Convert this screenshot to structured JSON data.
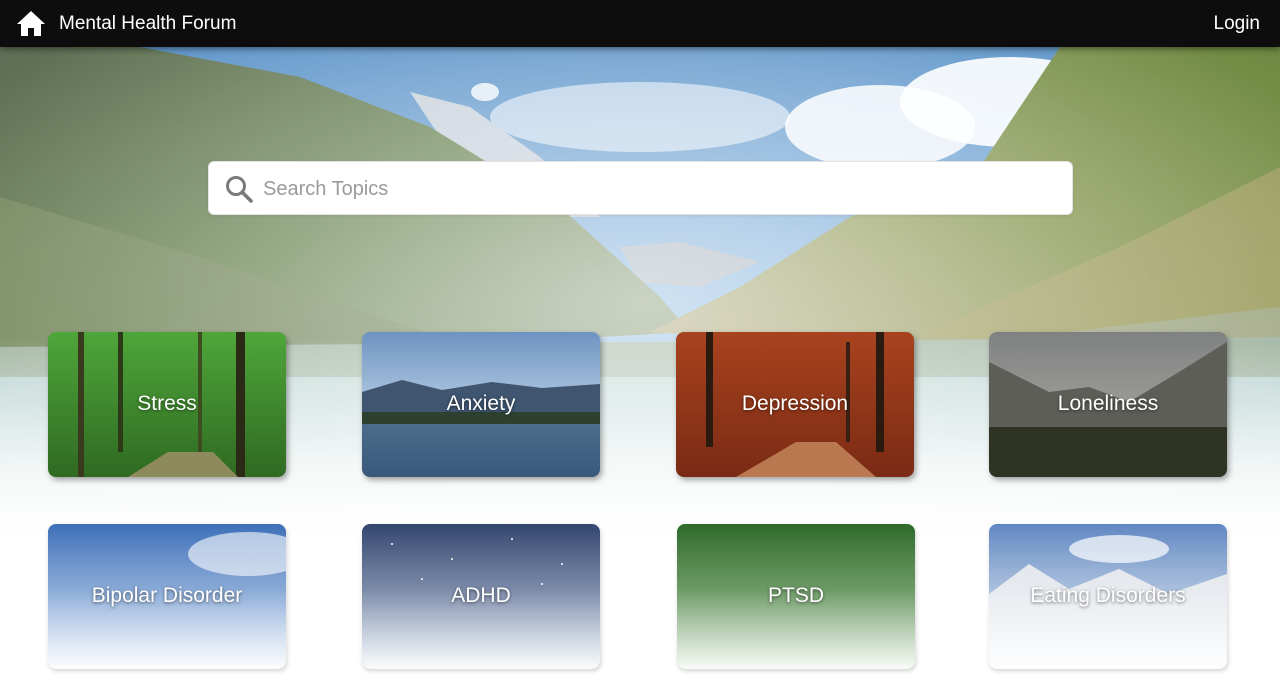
{
  "navbar": {
    "home_icon": "home-icon",
    "brand": "Mental Health Forum",
    "login": "Login"
  },
  "hero": {
    "background": "mountain-lake-valley-photo"
  },
  "search": {
    "icon": "search-icon",
    "placeholder": "Search Topics",
    "value": ""
  },
  "topics": [
    {
      "label": "Stress",
      "image": "green-forest-path"
    },
    {
      "label": "Anxiety",
      "image": "calm-mountain-lake"
    },
    {
      "label": "Depression",
      "image": "autumn-forest-path"
    },
    {
      "label": "Loneliness",
      "image": "misty-mountain-forest"
    },
    {
      "label": "Bipolar Disorder",
      "image": "blue-sky-clouds"
    },
    {
      "label": "ADHD",
      "image": "starry-night-sky"
    },
    {
      "label": "PTSD",
      "image": "green-grass-texture"
    },
    {
      "label": "Eating Disorders",
      "image": "snowy-mountains"
    }
  ],
  "colors": {
    "navbar_bg": "#0d0d0d",
    "navbar_text": "#ffffff",
    "search_placeholder": "#9a9a9a",
    "card_text": "#ffffff"
  }
}
